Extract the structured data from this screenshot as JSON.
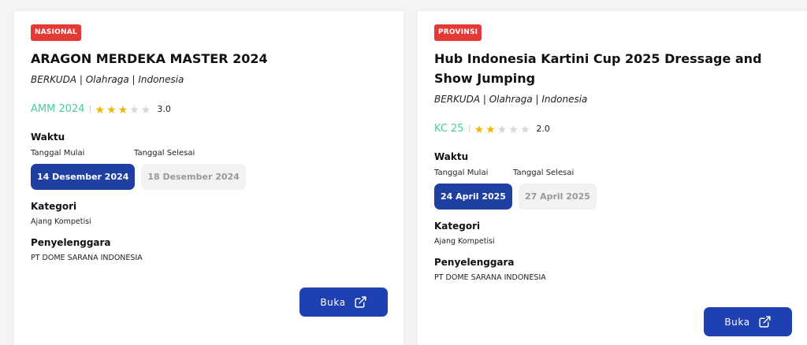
{
  "events": [
    {
      "badge": "NASIONAL",
      "badge_color": "#e53935",
      "title": "ARAGON MERDEKA MASTER 2024",
      "meta": "BERKUDA | Olahraga | Indonesia",
      "code": "AMM 2024",
      "rating": 3,
      "rating_max": 5,
      "score": "3.0",
      "waktu_label": "Waktu",
      "start_label": "Tanggal Mulai",
      "end_label": "Tanggal Selesai",
      "start_date": "14 Desember 2024",
      "end_date": "18 Desember 2024",
      "kategori_label": "Kategori",
      "kategori": "Ajang Kompetisi",
      "penyelenggara_label": "Penyelenggara",
      "penyelenggara": "PT DOME SARANA INDONESIA",
      "button_label": "Buka",
      "button_icon": "external-link-icon"
    },
    {
      "badge": "PROVINSI",
      "badge_color": "#e53935",
      "title": "Hub Indonesia Kartini Cup 2025 Dressage and Show Jumping",
      "meta": "BERKUDA | Olahraga | Indonesia",
      "code": "KC 25",
      "rating": 2,
      "rating_max": 5,
      "score": "2.0",
      "waktu_label": "Waktu",
      "start_label": "Tanggal Mulai",
      "end_label": "Tanggal Selesai",
      "start_date": "24 April 2025",
      "end_date": "27 April 2025",
      "kategori_label": "Kategori",
      "kategori": "Ajang Kompetisi",
      "penyelenggara_label": "Penyelenggara",
      "penyelenggara": "PT DOME SARANA INDONESIA",
      "button_label": "Buka",
      "button_icon": "external-link-icon"
    }
  ],
  "colors": {
    "primary": "#1f40b0",
    "code": "#4cc9a0",
    "star_on": "#f2b705",
    "star_off": "#d7d7d7"
  }
}
